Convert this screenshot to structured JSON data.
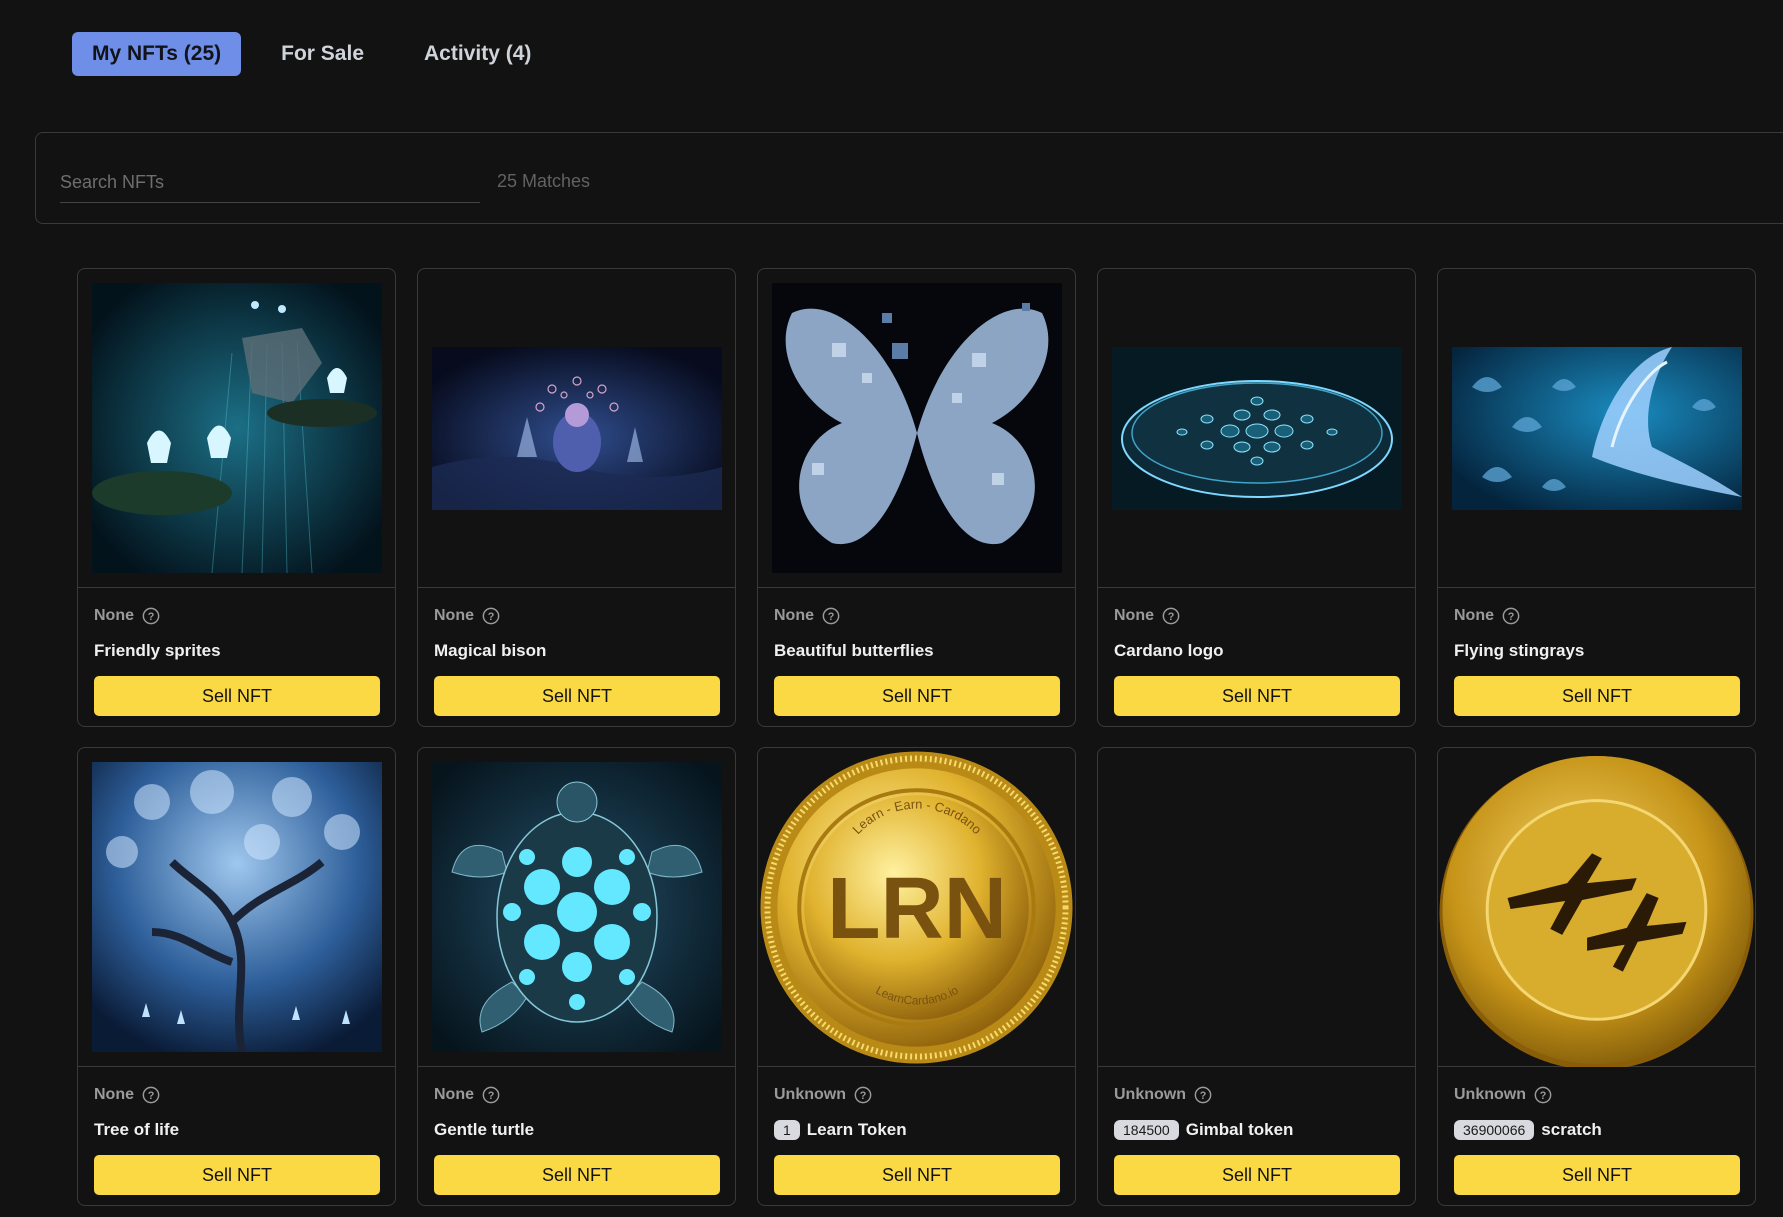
{
  "tabs": [
    {
      "label": "My NFTs (25)",
      "active": true
    },
    {
      "label": "For Sale",
      "active": false
    },
    {
      "label": "Activity (4)",
      "active": false
    }
  ],
  "search": {
    "placeholder": "Search NFTs",
    "value": "",
    "matches": "25 Matches"
  },
  "colors": {
    "accent_tab": "#6f8ee8",
    "sell_button": "#fbd944",
    "background": "#121212"
  },
  "cards": [
    {
      "policy": "None",
      "name": "Friendly sprites",
      "quantity": "",
      "sell_label": "Sell NFT",
      "image": "sprites-artwork"
    },
    {
      "policy": "None",
      "name": "Magical bison",
      "quantity": "",
      "sell_label": "Sell NFT",
      "image": "bison-artwork"
    },
    {
      "policy": "None",
      "name": "Beautiful butterflies",
      "quantity": "",
      "sell_label": "Sell NFT",
      "image": "butterfly-artwork"
    },
    {
      "policy": "None",
      "name": "Cardano logo",
      "quantity": "",
      "sell_label": "Sell NFT",
      "image": "cardano-logo-artwork"
    },
    {
      "policy": "None",
      "name": "Flying stingrays",
      "quantity": "",
      "sell_label": "Sell NFT",
      "image": "stingrays-artwork"
    },
    {
      "policy": "None",
      "name": "Tree of life",
      "quantity": "",
      "sell_label": "Sell NFT",
      "image": "tree-artwork"
    },
    {
      "policy": "None",
      "name": "Gentle turtle",
      "quantity": "",
      "sell_label": "Sell NFT",
      "image": "turtle-artwork"
    },
    {
      "policy": "Unknown",
      "name": "Learn Token",
      "quantity": "1",
      "sell_label": "Sell NFT",
      "image": "lrn-coin",
      "coin_text": "LRN",
      "coin_top_text": "Learn - Earn - Cardano",
      "coin_bottom_text": "LearnCardano.io"
    },
    {
      "policy": "Unknown",
      "name": "Gimbal token",
      "quantity": "184500",
      "sell_label": "Sell NFT",
      "image": "none"
    },
    {
      "policy": "Unknown",
      "name": "scratch",
      "quantity": "36900066",
      "sell_label": "Sell NFT",
      "image": "scratch-coin"
    }
  ]
}
